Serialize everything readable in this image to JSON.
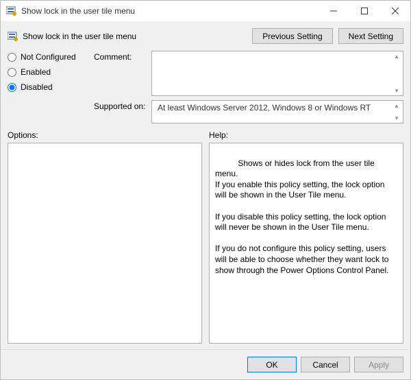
{
  "window": {
    "title": "Show lock in the user tile menu"
  },
  "header": {
    "heading": "Show lock in the user tile menu",
    "prev_btn": "Previous Setting",
    "next_btn": "Next Setting"
  },
  "state": {
    "options": {
      "not_configured": "Not Configured",
      "enabled": "Enabled",
      "disabled": "Disabled"
    },
    "selected": "disabled"
  },
  "labels": {
    "comment": "Comment:",
    "supported_on": "Supported on:",
    "options": "Options:",
    "help": "Help:"
  },
  "comment": "",
  "supported_on": "At least Windows Server 2012, Windows 8 or Windows RT",
  "help_text": "Shows or hides lock from the user tile menu.\nIf you enable this policy setting, the lock option will be shown in the User Tile menu.\n\nIf you disable this policy setting, the lock option will never be shown in the User Tile menu.\n\nIf you do not configure this policy setting, users will be able to choose whether they want lock to show through the Power Options Control Panel.",
  "footer": {
    "ok": "OK",
    "cancel": "Cancel",
    "apply": "Apply"
  }
}
